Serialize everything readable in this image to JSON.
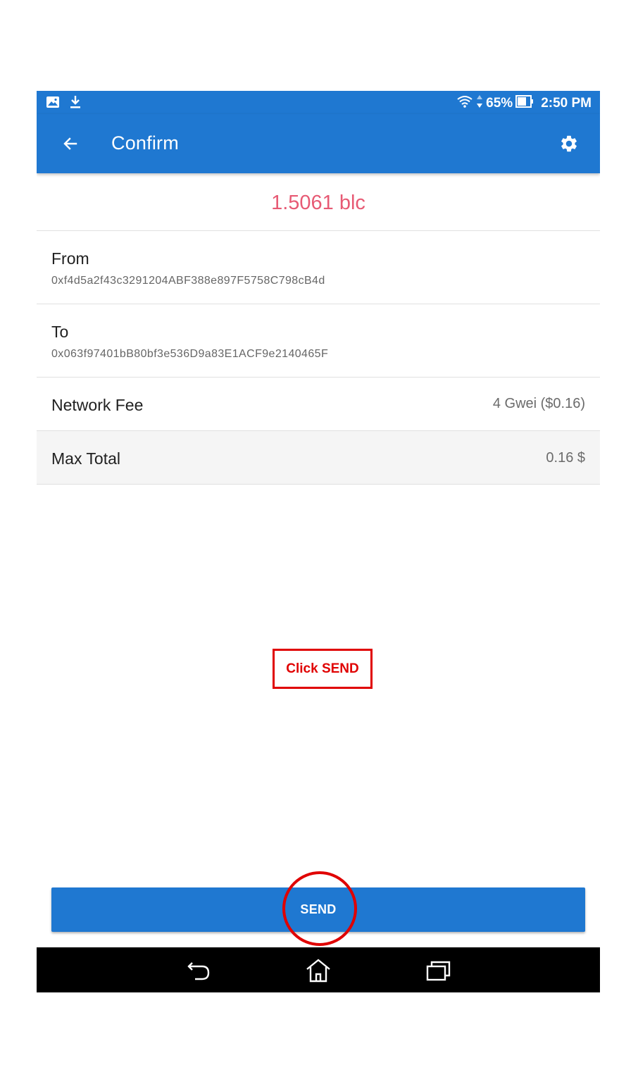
{
  "status_bar": {
    "battery_percent": "65%",
    "time": "2:50 PM",
    "left_icons": [
      "image-icon",
      "download-icon"
    ],
    "right_icons": [
      "wifi-icon",
      "data-arrows-icon",
      "battery-icon"
    ]
  },
  "app_bar": {
    "title": "Confirm",
    "back_icon": "arrow-back-icon",
    "settings_icon": "gear-icon",
    "color": "#1f78d1"
  },
  "amount": {
    "value": "1.5061 blc",
    "color": "#e75a74"
  },
  "from": {
    "label": "From",
    "address": "0xf4d5a2f43c3291204ABF388e897F5758C798cB4d"
  },
  "to": {
    "label": "To",
    "address": "0x063f97401bB80bf3e536D9a83E1ACF9e2140465F"
  },
  "network_fee": {
    "label": "Network Fee",
    "value": "4 Gwei ($0.16)"
  },
  "max_total": {
    "label": "Max Total",
    "value": "0.16 $"
  },
  "annotation": {
    "text": "Click SEND",
    "color": "#e00000"
  },
  "send_button": {
    "label": "SEND"
  },
  "nav_bar": {
    "icons": [
      "nav-back-icon",
      "nav-home-icon",
      "nav-recent-apps-icon"
    ]
  }
}
